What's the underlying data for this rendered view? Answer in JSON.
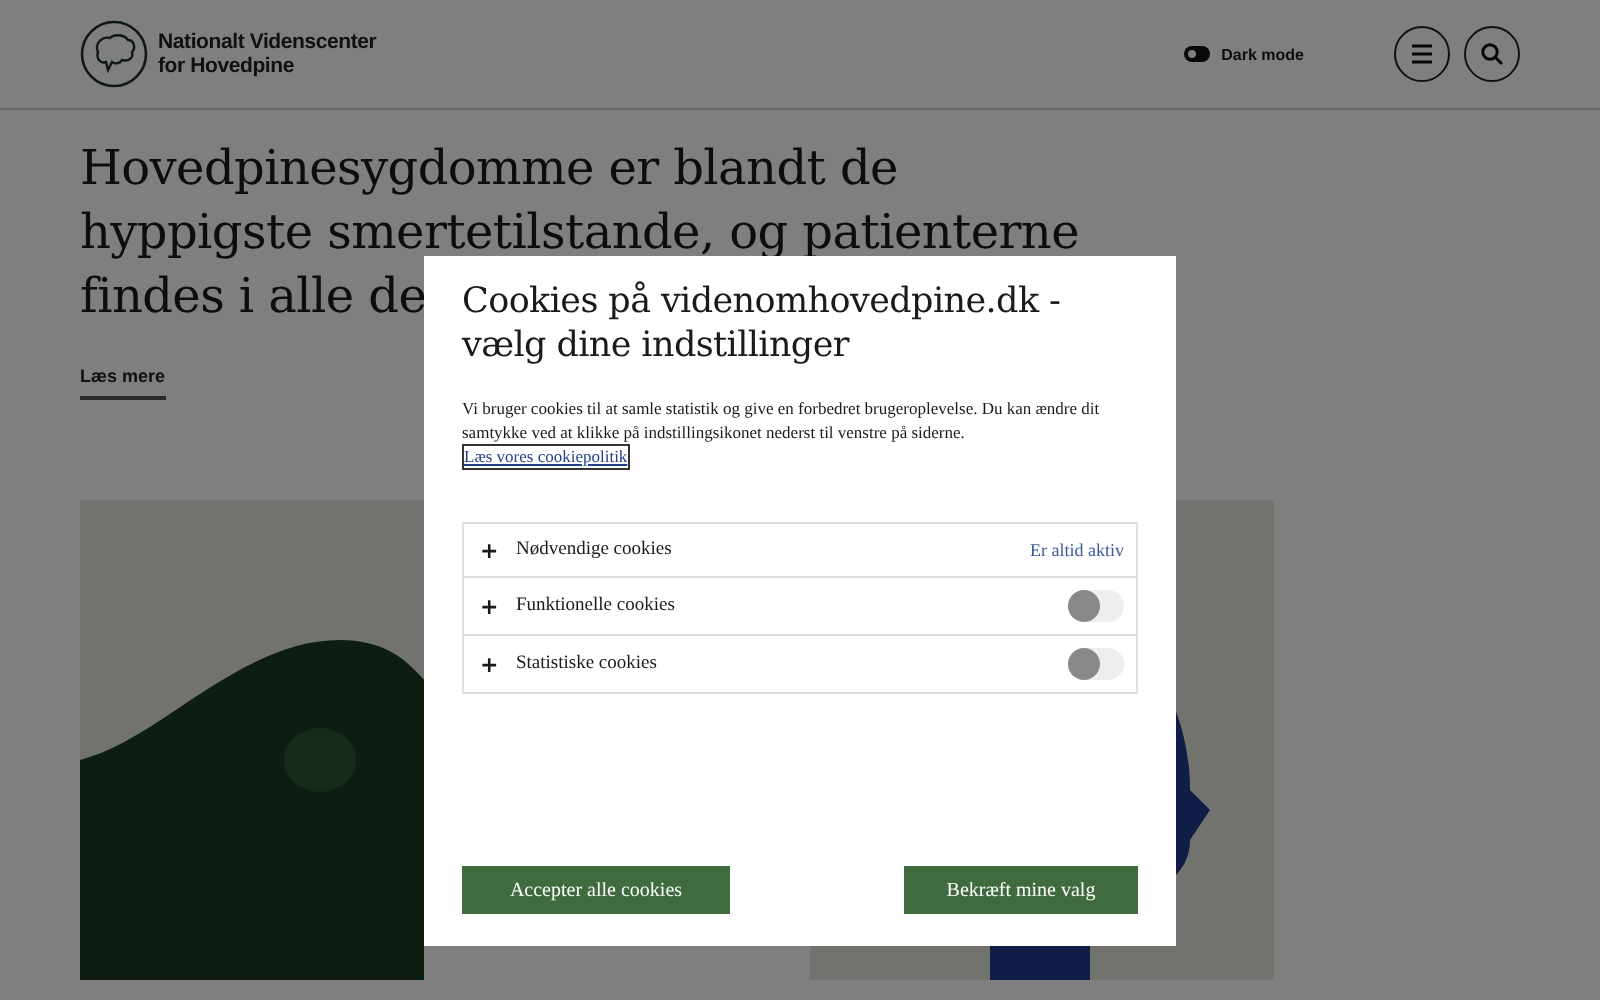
{
  "header": {
    "logo_text_lines": [
      "Nationalt Videnscenter",
      "for Hovedpine"
    ],
    "dark_mode": {
      "label": "Dark mode",
      "on": false
    }
  },
  "hero": {
    "headline_lines": [
      "Hovedpinesygdomme er blandt de",
      "hyppigste smertetilstande, og patienterne",
      "findes i alle de"
    ],
    "link": "Læs mere"
  },
  "cookie_dialog": {
    "title": "Cookies på videnomhovedpine.dk - vælg dine indstillinger",
    "text": "Vi bruger cookies til at samle statistik og give en forbedret brugeroplevelse. Du kan ændre dit samtykke ved at klikke på indstillingsikonet nederst til venstre på siderne.",
    "policy_link": "Læs vores cookiepolitik",
    "categories": [
      {
        "expander": "+",
        "label": "Nødvendige cookies",
        "kind": "always",
        "status": "Er altid aktiv"
      },
      {
        "expander": "+",
        "label": "Funktionelle cookies",
        "kind": "toggle",
        "on": false
      },
      {
        "expander": "+",
        "label": "Statistiske cookies",
        "kind": "toggle",
        "on": false
      }
    ],
    "buttons": [
      "Accepter alle cookies",
      "Bekræft mine valg"
    ]
  }
}
